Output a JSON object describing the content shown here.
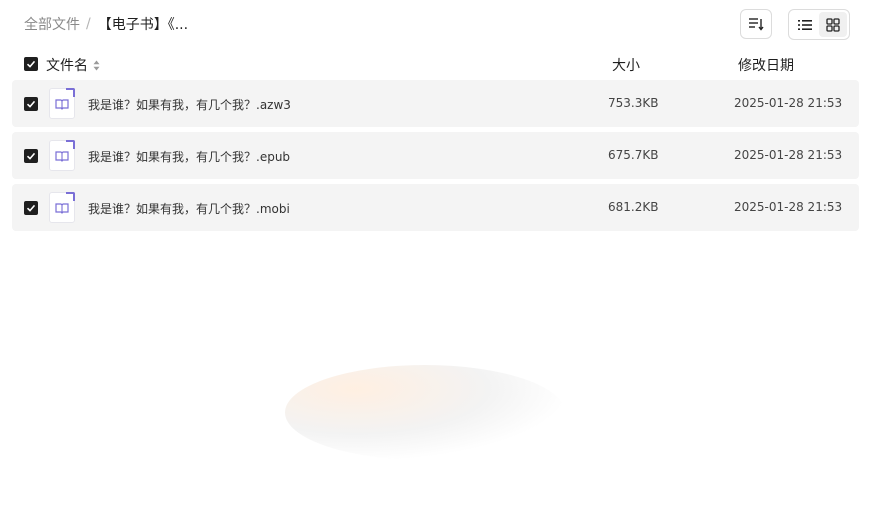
{
  "breadcrumb": {
    "root": "全部文件",
    "separator": "/",
    "current": "【电子书】《..."
  },
  "toolbar": {
    "sort_icon": "sort-icon",
    "list_icon": "list-view-icon",
    "grid_icon": "grid-view-icon"
  },
  "table": {
    "columns": {
      "name": "文件名",
      "size": "大小",
      "date": "修改日期"
    },
    "rows": [
      {
        "name": "我是谁？如果有我，有几个我？.azw3",
        "size": "753.3KB",
        "date": "2025-01-28 21:53",
        "checked": true
      },
      {
        "name": "我是谁？如果有我，有几个我？.epub",
        "size": "675.7KB",
        "date": "2025-01-28 21:53",
        "checked": true
      },
      {
        "name": "我是谁？如果有我，有几个我？.mobi",
        "size": "681.2KB",
        "date": "2025-01-28 21:53",
        "checked": true
      }
    ]
  },
  "colors": {
    "accent": "#7a6fd6",
    "row_bg": "#f4f4f4",
    "checkbox": "#1f1f1f"
  }
}
